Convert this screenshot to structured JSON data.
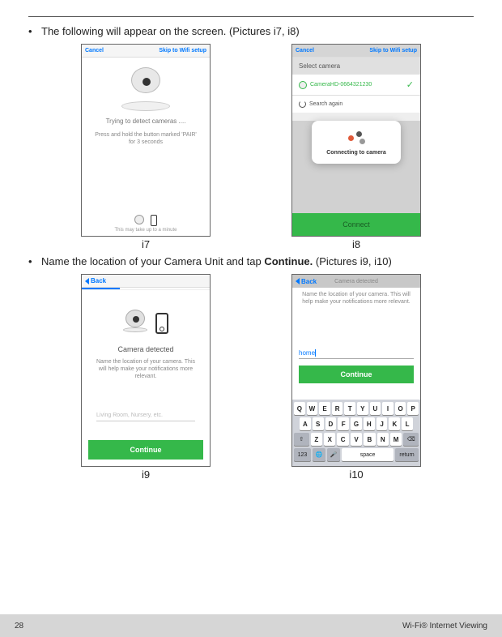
{
  "bullets": {
    "line1_prefix": "The following will appear on the screen. (Pictures i7, i8)",
    "line2_prefix": "Name the location of your Camera Unit and tap ",
    "line2_bold": "Continue.",
    "line2_suffix": " (Pictures i9, i10)"
  },
  "labels": {
    "i7": "i7",
    "i8": "i8",
    "i9": "i9",
    "i10": "i10"
  },
  "i7": {
    "cancel": "Cancel",
    "skip": "Skip to Wifi setup",
    "detecting": "Trying to detect cameras ....",
    "instruction": "Press and hold the button marked 'PAIR' for 3 seconds",
    "footer": "This may take up to a minute"
  },
  "i8": {
    "cancel": "Cancel",
    "skip": "Skip to Wifi setup",
    "section": "Select camera",
    "camera_id": "CameraHD-0664321230",
    "search": "Search again",
    "dialog": "Connecting to camera",
    "connect": "Connect"
  },
  "i9": {
    "back": "Back",
    "title": "Camera detected",
    "subtitle": "Name the location of your camera. This will help make your notifications more relevant.",
    "placeholder": "Living Room, Nursery, etc.",
    "continue": "Continue",
    "progress": "30%"
  },
  "i10": {
    "back": "Back",
    "header_title": "Camera detected",
    "subtitle": "Name the location of your camera. This will help make your notifications more relevant.",
    "input_value": "home",
    "continue": "Continue",
    "keyboard": {
      "row1": [
        "Q",
        "W",
        "E",
        "R",
        "T",
        "Y",
        "U",
        "I",
        "O",
        "P"
      ],
      "row2": [
        "A",
        "S",
        "D",
        "F",
        "G",
        "H",
        "J",
        "K",
        "L"
      ],
      "row3": [
        "Z",
        "X",
        "C",
        "V",
        "B",
        "N",
        "M"
      ],
      "shift": "⇧",
      "del": "⌫",
      "k123": "123",
      "globe": "🌐",
      "mic": "🎤",
      "space": "space",
      "return": "return"
    }
  },
  "footer": {
    "page": "28",
    "section": "Wi-Fi® Internet Viewing"
  }
}
